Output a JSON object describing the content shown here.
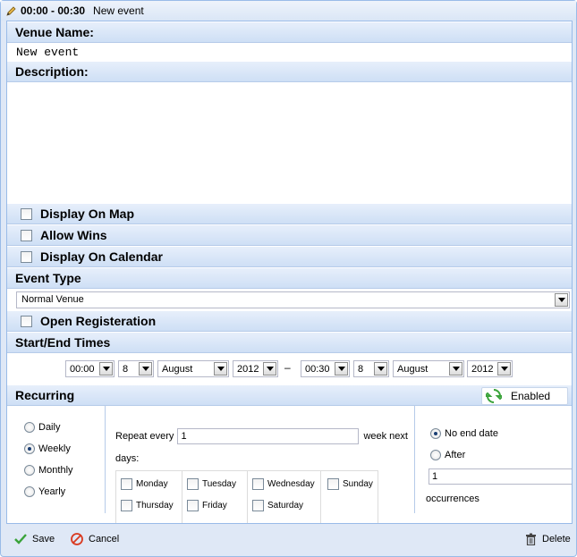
{
  "window": {
    "title_time": "00:00 - 00:30",
    "title_event": "New event"
  },
  "venue": {
    "label": "Venue Name:",
    "value": "New event"
  },
  "description": {
    "label": "Description:",
    "value": ""
  },
  "options": [
    {
      "label": "Display On Map",
      "checked": false
    },
    {
      "label": "Allow Wins",
      "checked": false
    },
    {
      "label": "Display On Calendar",
      "checked": false
    }
  ],
  "event_type": {
    "label": "Event Type",
    "selected": "Normal Venue"
  },
  "open_registration": {
    "label": "Open Registeration",
    "checked": false
  },
  "times": {
    "label": "Start/End Times",
    "start": {
      "time": "00:00",
      "day": "8",
      "month": "August",
      "year": "2012"
    },
    "separator": "–",
    "end": {
      "time": "00:30",
      "day": "8",
      "month": "August",
      "year": "2012"
    }
  },
  "recurring": {
    "label": "Recurring",
    "toggle_label": "Enabled",
    "frequencies": [
      "Daily",
      "Weekly",
      "Monthly",
      "Yearly"
    ],
    "selected_frequency": "Weekly",
    "repeat_prefix": "Repeat every",
    "repeat_value": "1",
    "repeat_suffix": "week next",
    "days_label": "days:",
    "days": [
      "Monday",
      "Tuesday",
      "Wednesday",
      "Sunday",
      "Thursday",
      "Friday",
      "Saturday"
    ],
    "end_options": [
      "No end date",
      "After"
    ],
    "selected_end": "No end date",
    "occurrences_value": "1",
    "occurrences_label": "occurrences"
  },
  "footer": {
    "save": "Save",
    "cancel": "Cancel",
    "delete": "Delete"
  },
  "colors": {
    "header_bg": "#cedff5",
    "border": "#99bbe8",
    "save_icon": "#3aa33a",
    "cancel_icon": "#d9391f"
  }
}
